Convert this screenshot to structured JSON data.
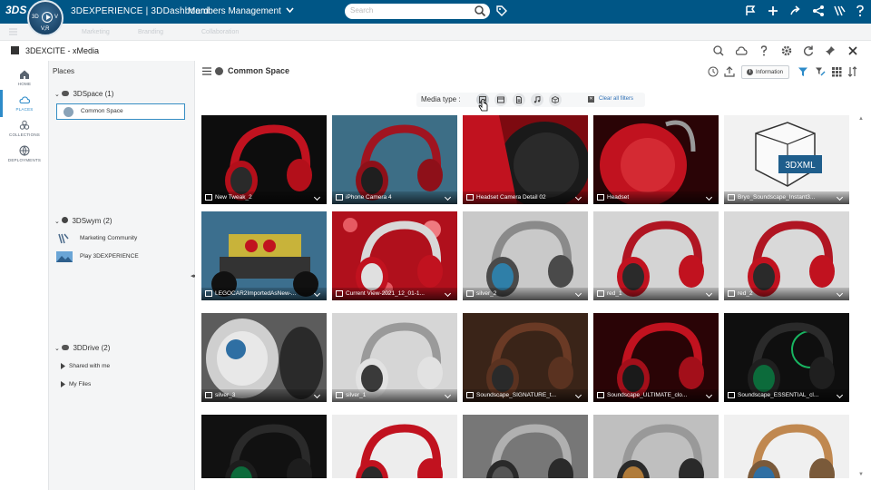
{
  "topbar": {
    "brand_logo": "3DS",
    "compass": {
      "left": "3D",
      "right": "V",
      "bottom": "V,R"
    },
    "app_name": "3DEXPERIENCE | 3DDashboard",
    "dashboard_name": "Members Management",
    "search_placeholder": "Search"
  },
  "subbar": {
    "ghost_tabs": [
      "Marketing",
      "Branding",
      "Collaboration"
    ]
  },
  "widget": {
    "title": "3DEXCITE - xMedia"
  },
  "leftnav": {
    "items": [
      {
        "label": "HOME",
        "icon": "home-icon"
      },
      {
        "label": "PLACES",
        "icon": "cloud-icon"
      },
      {
        "label": "COLLECTIONS",
        "icon": "collections-icon"
      },
      {
        "label": "DEPLOYMENTS",
        "icon": "globe-icon"
      }
    ]
  },
  "places": {
    "title": "Places",
    "groups": [
      {
        "label": "3DSpace",
        "count": "(1)"
      },
      {
        "label": "3DSwym",
        "count": "(2)"
      },
      {
        "label": "3DDrive",
        "count": "(2)"
      }
    ],
    "items": {
      "common_space": "Common Space",
      "marketing_community": "Marketing Community",
      "play_3dexperience": "Play 3DEXPERIENCE",
      "shared_with_me": "Shared with me",
      "my_files": "My Files"
    }
  },
  "main": {
    "title": "Common Space",
    "info_label": "Information",
    "media_type_label": "Media type :",
    "clear_filters": "Clear all filters"
  },
  "cards": [
    {
      "name": "New Tweak_2",
      "kind": "image"
    },
    {
      "name": "iPhone Camera 4",
      "kind": "image"
    },
    {
      "name": "Headset Camera Detail 02",
      "kind": "image"
    },
    {
      "name": "Headset",
      "kind": "image"
    },
    {
      "name": "Bryo_Soundscape_Instant3...",
      "kind": "3dxml",
      "badge": "3DXML"
    },
    {
      "name": "LEGOCAR2ImportedAsNew-...",
      "kind": "image"
    },
    {
      "name": "Current View-2021_12_01-1...",
      "kind": "image"
    },
    {
      "name": "silver_2",
      "kind": "image"
    },
    {
      "name": "red_1",
      "kind": "image"
    },
    {
      "name": "red_2",
      "kind": "image"
    },
    {
      "name": "silver_3",
      "kind": "image"
    },
    {
      "name": "silver_1",
      "kind": "image"
    },
    {
      "name": "Soundscape_SIGNATURE_t...",
      "kind": "image"
    },
    {
      "name": "Soundscape_ULTIMATE_clo...",
      "kind": "image"
    },
    {
      "name": "Soundscape_ESSENTIAL_cl...",
      "kind": "image"
    },
    {
      "name": "",
      "kind": "image"
    },
    {
      "name": "",
      "kind": "image"
    },
    {
      "name": "",
      "kind": "image"
    },
    {
      "name": "",
      "kind": "image"
    },
    {
      "name": "",
      "kind": "image"
    }
  ],
  "colors": {
    "topbar": "#005686",
    "accent": "#2d8bc9",
    "link": "#2d6fb5",
    "headset_red": "#c1121f"
  }
}
